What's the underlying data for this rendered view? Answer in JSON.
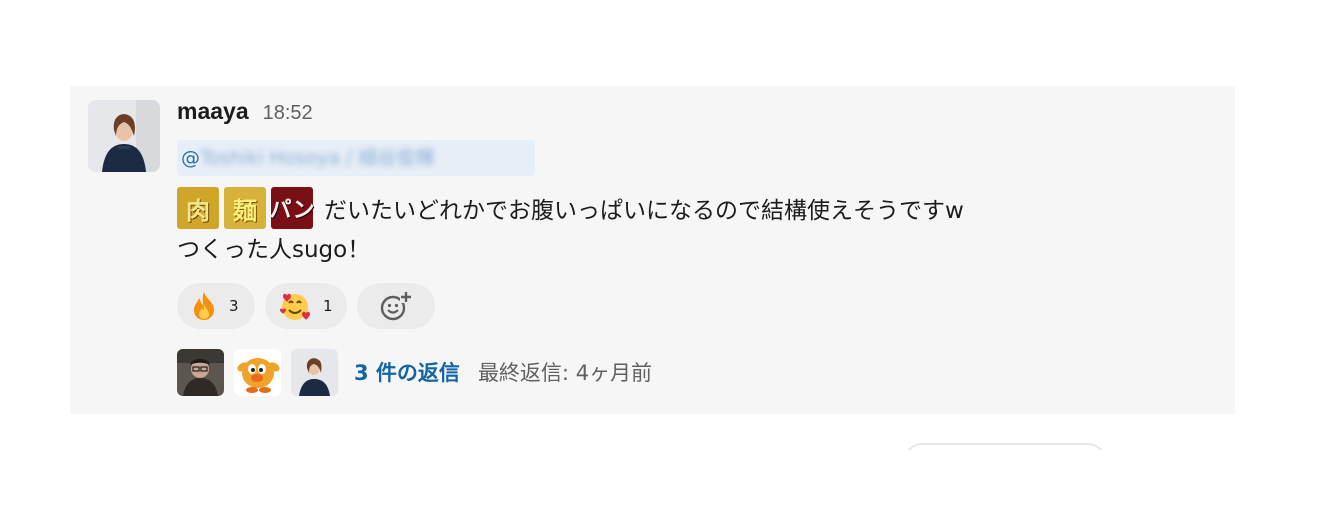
{
  "message": {
    "username": "maaya",
    "timestamp": "18:52",
    "mention": {
      "at": "@",
      "name_blurred": "Toshiki Hosoya / 細谷俊輝"
    },
    "emoji_tiles": [
      {
        "name": "niku",
        "glyph": "肉"
      },
      {
        "name": "men",
        "glyph": "麺"
      },
      {
        "name": "pan",
        "glyph": "パン"
      }
    ],
    "line1": "だいたいどれかでお腹いっぱいになるので結構使えそうですw",
    "line2": "つくった人sugo！",
    "reactions": [
      {
        "emoji": "🔥",
        "name": "fire",
        "count": "3"
      },
      {
        "emoji": "🥰",
        "name": "smiling-face-with-hearts",
        "count": "1"
      }
    ],
    "replies": {
      "count_label": "3 件の返信",
      "last_reply_label": "最終返信: 4ヶ月前"
    }
  }
}
